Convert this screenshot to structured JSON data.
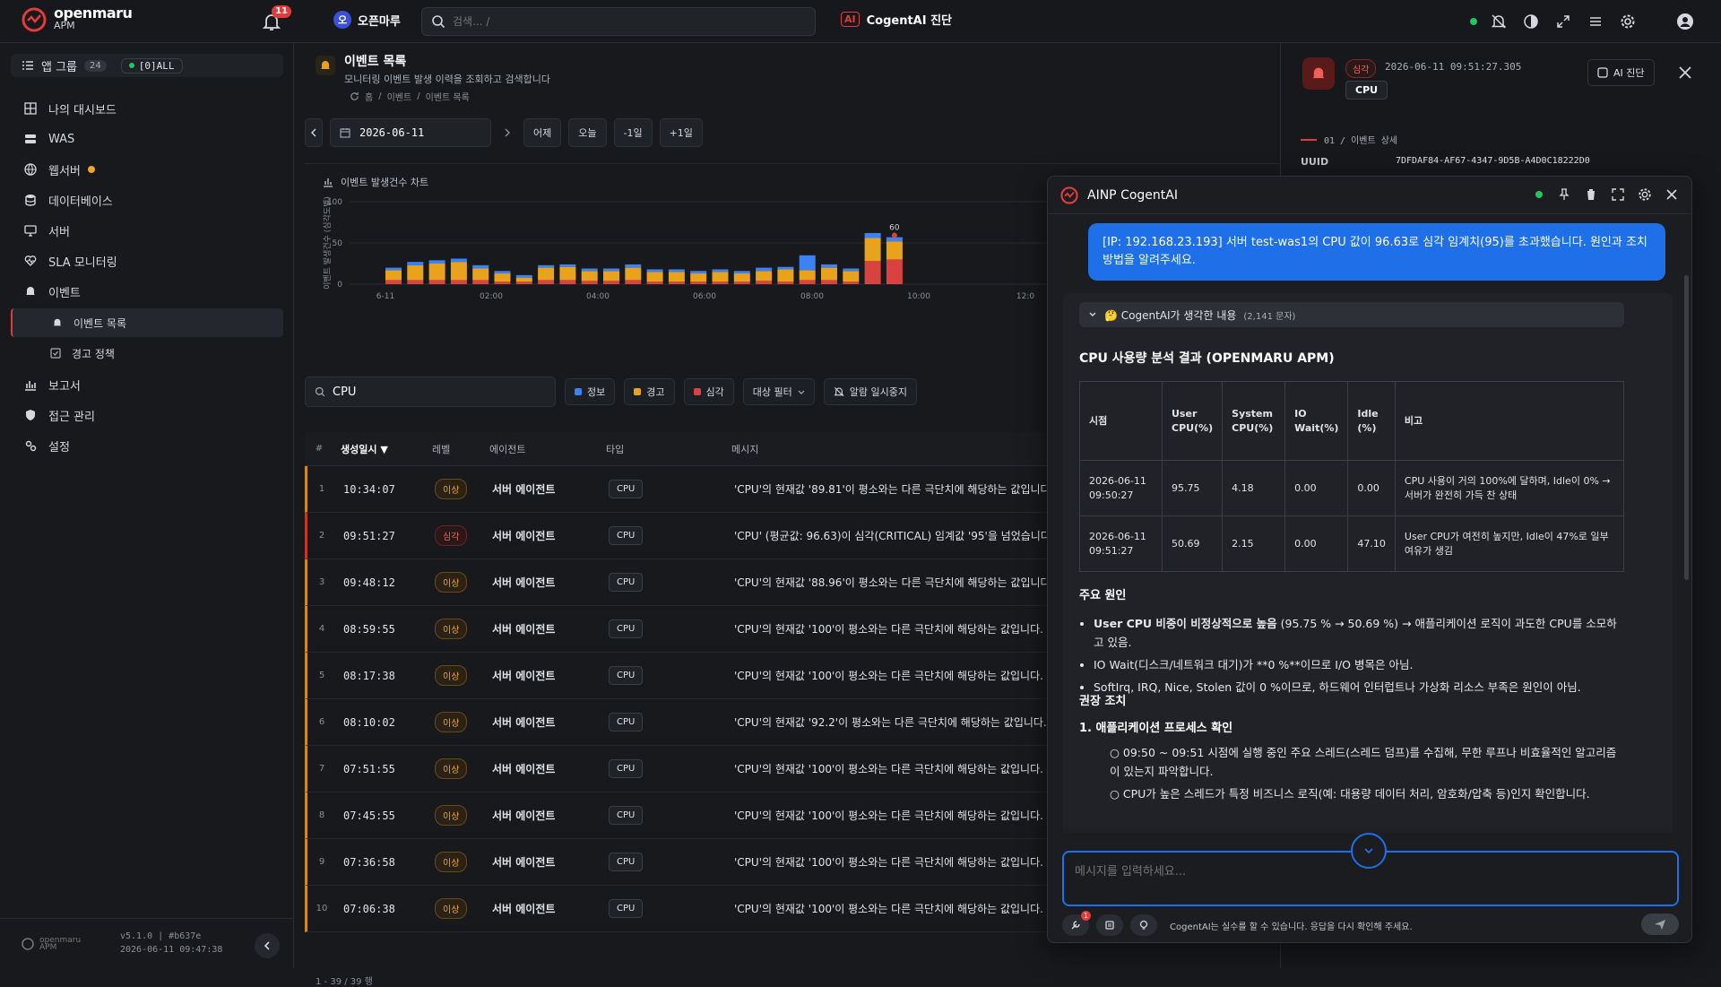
{
  "topbar": {
    "brand_name": "openmaru",
    "brand_sub": "APM",
    "notification_count": "11",
    "tenant_initial": "오",
    "tenant_name": "오픈마루",
    "search_placeholder": "검색... /",
    "cogent_badge": "AI",
    "cogent_label": "CogentAI 진단"
  },
  "sidebar": {
    "app_group_label": "앱 그룹",
    "app_group_count": "24",
    "app_group_filter": "[0]ALL",
    "items": [
      {
        "label": "나의 대시보드",
        "icon": "grid-icon"
      },
      {
        "label": "WAS",
        "icon": "server-stack-icon"
      },
      {
        "label": "웹서버",
        "icon": "globe-icon"
      },
      {
        "label": "데이터베이스",
        "icon": "database-icon"
      },
      {
        "label": "서버",
        "icon": "monitor-icon"
      },
      {
        "label": "SLA 모니터링",
        "icon": "heart-icon"
      },
      {
        "label": "이벤트",
        "icon": "bell-icon"
      },
      {
        "label": "보고서",
        "icon": "chart-icon"
      },
      {
        "label": "접근 관리",
        "icon": "shield-icon"
      },
      {
        "label": "설정",
        "icon": "gear-icon"
      }
    ],
    "sub_items": [
      {
        "label": "이벤트 목록"
      },
      {
        "label": "경고 정책"
      }
    ],
    "footer_brand": "openmaru",
    "footer_brand_sub": "APM",
    "version": "v5.1.0 | #b637e",
    "build_time": "2026-06-11 09:47:38"
  },
  "page": {
    "title": "이벤트 목록",
    "description": "모니터링 이벤트 발생 이력을 조회하고 검색합니다",
    "breadcrumb": [
      "홈",
      "이벤트",
      "이벤트 목록"
    ],
    "date_value": "2026-06-11",
    "date_buttons": [
      "어제",
      "오늘",
      "-1일",
      "+1일"
    ],
    "chart_title": "이벤트 발생건수 차트",
    "filter_value": "CPU",
    "level_chips": [
      "정보",
      "경고",
      "심각"
    ],
    "target_filter": "대상 필터",
    "mute_label": "알람 일시중지",
    "count_label": "1 - 39 / 39 행"
  },
  "colors": {
    "info": "#3b82f6",
    "warning": "#e8a21c",
    "critical": "#d9433f",
    "accent": "#1f6fe8"
  },
  "chart_data": {
    "type": "bar",
    "stacked": true,
    "ylabel": "이벤트 발생건수 (심각도별)",
    "ylim": [
      0,
      100
    ],
    "y_ticks": [
      0,
      50,
      100
    ],
    "x_ticks": [
      "6-11",
      "02:00",
      "04:00",
      "06:00",
      "08:00",
      "10:00",
      "12:0"
    ],
    "annotation": {
      "index": 23,
      "label": "60"
    },
    "series": [
      {
        "name": "심각",
        "values": [
          5,
          5,
          5,
          5,
          5,
          3,
          3,
          5,
          5,
          4,
          4,
          5,
          3,
          3,
          3,
          3,
          3,
          4,
          3,
          5,
          5,
          3,
          28,
          30
        ]
      },
      {
        "name": "경고",
        "values": [
          12,
          18,
          20,
          22,
          14,
          10,
          5,
          15,
          16,
          12,
          12,
          15,
          12,
          12,
          10,
          12,
          10,
          12,
          15,
          12,
          15,
          13,
          28,
          22
        ]
      },
      {
        "name": "정보",
        "values": [
          3,
          4,
          4,
          4,
          4,
          3,
          3,
          3,
          3,
          3,
          3,
          4,
          3,
          3,
          3,
          3,
          3,
          4,
          3,
          18,
          4,
          3,
          6,
          5
        ]
      }
    ]
  },
  "table": {
    "headers": [
      "#",
      "생성일시",
      "레벨",
      "에이전트",
      "타입",
      "메시지"
    ],
    "rows": [
      {
        "no": "1",
        "time": "10:34:07",
        "level": "이상",
        "agent": "서버 에이전트",
        "type": "CPU",
        "message": "'CPU'의 현재값 '89.81'이 평소와는 다른 극단치에 해당하는 값입니다.",
        "crit": false
      },
      {
        "no": "2",
        "time": "09:51:27",
        "level": "심각",
        "agent": "서버 에이전트",
        "type": "CPU",
        "message": "'CPU' (평균값: 96.63)이 심각(CRITICAL) 임계값 '95'을 넘었습니다.",
        "crit": true
      },
      {
        "no": "3",
        "time": "09:48:12",
        "level": "이상",
        "agent": "서버 에이전트",
        "type": "CPU",
        "message": "'CPU'의 현재값 '88.96'이 평소와는 다른 극단치에 해당하는 값입니다.",
        "crit": false
      },
      {
        "no": "4",
        "time": "08:59:55",
        "level": "이상",
        "agent": "서버 에이전트",
        "type": "CPU",
        "message": "'CPU'의 현재값 '100'이 평소와는 다른 극단치에 해당하는 값입니다.",
        "crit": false
      },
      {
        "no": "5",
        "time": "08:17:38",
        "level": "이상",
        "agent": "서버 에이전트",
        "type": "CPU",
        "message": "'CPU'의 현재값 '100'이 평소와는 다른 극단치에 해당하는 값입니다.",
        "crit": false
      },
      {
        "no": "6",
        "time": "08:10:02",
        "level": "이상",
        "agent": "서버 에이전트",
        "type": "CPU",
        "message": "'CPU'의 현재값 '92.2'이 평소와는 다른 극단치에 해당하는 값입니다.",
        "crit": false
      },
      {
        "no": "7",
        "time": "07:51:55",
        "level": "이상",
        "agent": "서버 에이전트",
        "type": "CPU",
        "message": "'CPU'의 현재값 '100'이 평소와는 다른 극단치에 해당하는 값입니다.",
        "crit": false
      },
      {
        "no": "8",
        "time": "07:45:55",
        "level": "이상",
        "agent": "서버 에이전트",
        "type": "CPU",
        "message": "'CPU'의 현재값 '100'이 평소와는 다른 극단치에 해당하는 값입니다.",
        "crit": false
      },
      {
        "no": "9",
        "time": "07:36:58",
        "level": "이상",
        "agent": "서버 에이전트",
        "type": "CPU",
        "message": "'CPU'의 현재값 '100'이 평소와는 다른 극단치에 해당하는 값입니다.",
        "crit": false
      },
      {
        "no": "10",
        "time": "07:06:38",
        "level": "이상",
        "agent": "서버 에이전트",
        "type": "CPU",
        "message": "'CPU'의 현재값 '100'이 평소와는 다른 극단치에 해당하는 값입니다.",
        "crit": false
      }
    ]
  },
  "detail": {
    "level": "심각",
    "timestamp": "2026-06-11 09:51:27.305",
    "type": "CPU",
    "ai_button": "AI 진단",
    "section_label": "01 / 이벤트 상세",
    "uuid_label": "UUID",
    "uuid_value": "7DFDAF84-AF67-4347-9D5B-A4D0C18222D0"
  },
  "chat": {
    "title": "AINP CogentAI",
    "user_message": "[IP: 192.168.23.193] 서버 test-was1의 CPU 값이 96.63로 심각 임계치(95)를 초과했습니다. 원인과 조치 방법을 알려주세요.",
    "thinking_label": "🤔 CogentAI가 생각한 내용",
    "thinking_count": "(2,141 문자)",
    "result_title": "CPU 사용량 분석 결과 (OPENMARU APM)",
    "table_headers": [
      "시점",
      "User CPU(%)",
      "System CPU(%)",
      "IO Wait(%)",
      "Idle (%)",
      "비고"
    ],
    "table_rows": [
      [
        "2026-06-11 09:50:27",
        "95.75",
        "4.18",
        "0.00",
        "0.00",
        "CPU 사용이 거의 100%에 달하며, Idle이 0% → 서버가 완전히 가득 찬 상태"
      ],
      [
        "2026-06-11 09:51:27",
        "50.69",
        "2.15",
        "0.00",
        "47.10",
        "User CPU가 여전히 높지만, Idle이 47%로 일부 여유가 생김"
      ]
    ],
    "cause_title": "주요 원인",
    "cause_1_bold": "User CPU 비중이 비정상적으로 높음",
    "cause_1_rest": " (95.75 % → 50.69 %) → 애플리케이션 로직이 과도한 CPU를 소모하고 있음.",
    "cause_2": "IO Wait(디스크/네트워크 대기)가 **0 %**이므로 I/O 병목은 아님.",
    "cause_3": "SoftIrq, IRQ, Nice, Stolen 값이 0 %이므로, 하드웨어 인터럽트나 가상화 리소스 부족은 원인이 아님.",
    "action_title": "권장 조치",
    "action_1": "1. 애플리케이션 프로세스 확인",
    "action_1_sub1": "09:50 ~ 09:51 시점에 실행 중인 주요 스레드(스레드 덤프)를 수집해, 무한 루프나 비효율적인 알고리즘이 있는지 파악합니다.",
    "action_1_sub2": "CPU가 높은 스레드가 특정 비즈니스 로직(예: 대용량 데이터 처리, 암호화/압축 등)인지 확인합니다.",
    "input_placeholder": "메시지를 입력하세요...",
    "tools_badge": "1",
    "disclaimer": "CogentAI는 실수를 할 수 있습니다. 응답을 다시 확인해 주세요."
  }
}
